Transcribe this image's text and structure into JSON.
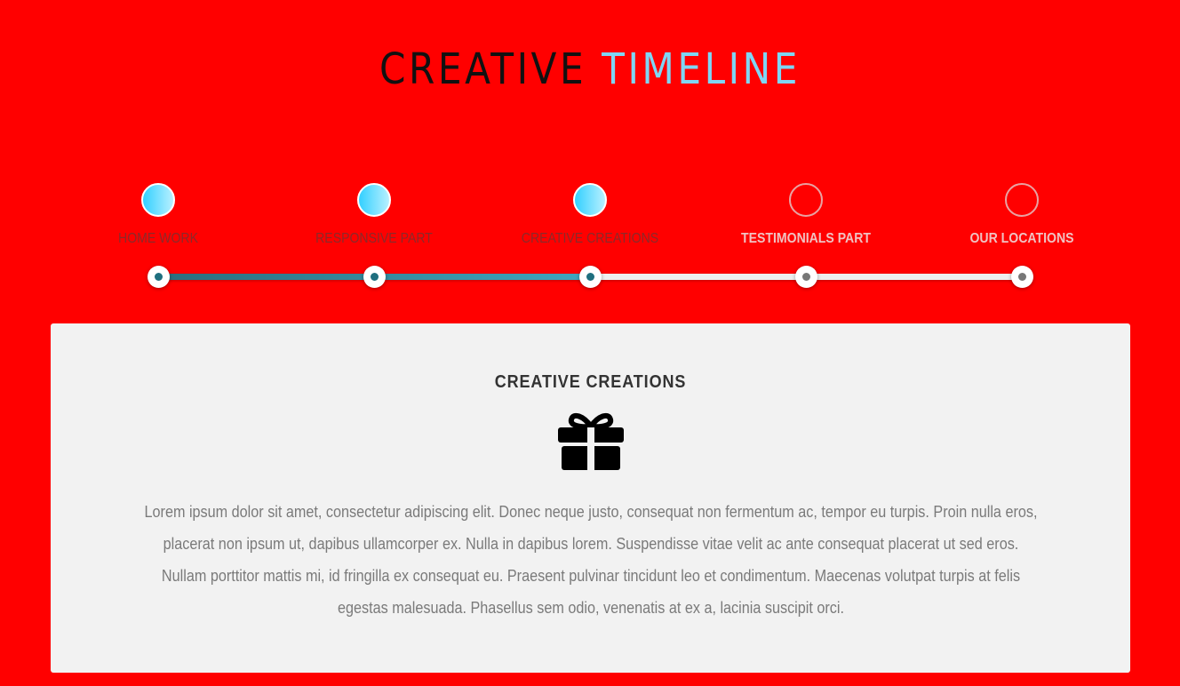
{
  "header": {
    "title_part1": "CREATIVE",
    "title_part2": "TIMELINE"
  },
  "timeline": {
    "steps": [
      {
        "label": "HOME WORK",
        "state": "done"
      },
      {
        "label": "RESPONSIVE PART",
        "state": "done"
      },
      {
        "label": "CREATIVE CREATIONS",
        "state": "active"
      },
      {
        "label": "TESTIMONIALS PART",
        "state": "upcoming"
      },
      {
        "label": "OUR LOCATIONS",
        "state": "upcoming"
      }
    ],
    "progress": 0.5
  },
  "card": {
    "title": "CREATIVE CREATIONS",
    "icon": "gift-icon",
    "text": "Lorem ipsum dolor sit amet, consectetur adipiscing elit. Donec neque justo, consequat non fermentum ac, tempor eu turpis. Proin nulla eros, placerat non ipsum ut, dapibus ullamcorper ex. Nulla in dapibus lorem. Suspendisse vitae velit ac ante consequat placerat ut sed eros. Nullam porttitor mattis mi, id fringilla ex consequat eu. Praesent pulvinar tincidunt leo et condimentum. Maecenas volutpat turpis at felis egestas malesuada. Phasellus sem odio, venenatis at ex a, lacinia suscipit orci."
  },
  "colors": {
    "background": "#ff0000",
    "accent": "#7fd6f5",
    "progress": "#2b8da3"
  }
}
